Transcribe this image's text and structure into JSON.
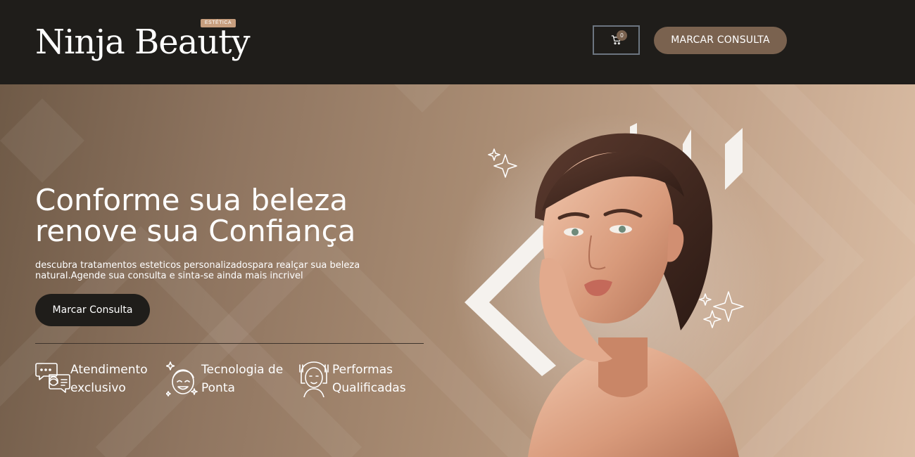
{
  "header": {
    "logo_text": "Ninja Beauty",
    "logo_badge": "ESTÉTICA",
    "cart_count": "0",
    "cta_label": "MARCAR CONSULTA"
  },
  "hero": {
    "headline_line1": "Conforme sua beleza",
    "headline_line2": "renove sua Confiança",
    "subtext_line1": "descubra tratamentos esteticos personalizadospara realçar sua beleza",
    "subtext_line2": "natural.Agende sua consulta e sinta-se ainda mais incrivel",
    "cta_label": "Marcar Consulta",
    "features": [
      {
        "line1": "Atendimento",
        "line2": "exclusivo",
        "icon": "chat-support-icon"
      },
      {
        "line1": "Tecnologia de",
        "line2": "Ponta",
        "icon": "face-sparkle-icon"
      },
      {
        "line1": "Performas",
        "line2": "Qualificadas",
        "icon": "facial-treatment-icon"
      }
    ]
  },
  "colors": {
    "header_bg": "#1f1d1a",
    "accent_brown": "#7a624f",
    "badge": "#c79e7e",
    "hero_light": "#dcbfa6",
    "hero_dark": "#6f5a47"
  }
}
